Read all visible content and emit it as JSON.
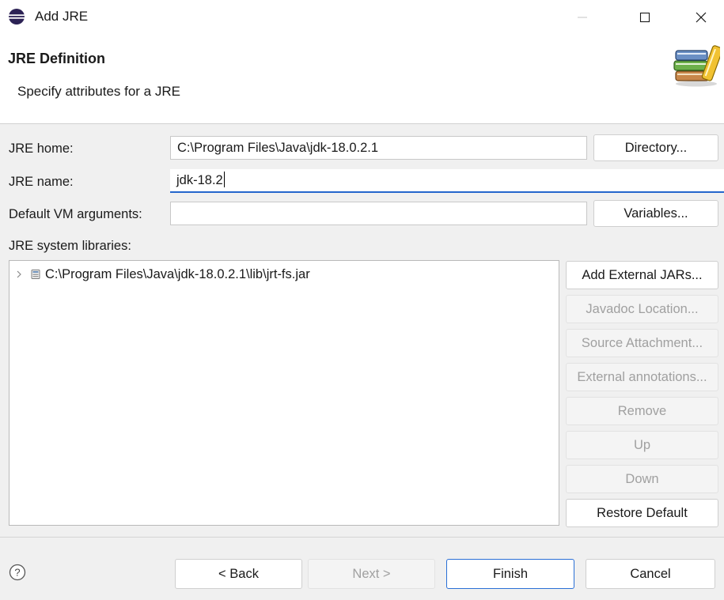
{
  "window": {
    "title": "Add JRE"
  },
  "header": {
    "title": "JRE Definition",
    "description": "Specify attributes for a JRE"
  },
  "form": {
    "jre_home": {
      "label": "JRE home:",
      "value": "C:\\Program Files\\Java\\jdk-18.0.2.1"
    },
    "jre_name": {
      "label": "JRE name:",
      "value": "jdk-18.2"
    },
    "vm_args": {
      "label": "Default VM arguments:",
      "value": ""
    },
    "libraries_label": "JRE system libraries:",
    "directory_button": "Directory...",
    "variables_button": "Variables..."
  },
  "libraries": {
    "items": [
      {
        "label": "C:\\Program Files\\Java\\jdk-18.0.2.1\\lib\\jrt-fs.jar",
        "icon": "jar-icon",
        "expanded": false
      }
    ],
    "buttons": [
      {
        "label": "Add External JARs...",
        "enabled": true
      },
      {
        "label": "Javadoc Location...",
        "enabled": false
      },
      {
        "label": "Source Attachment...",
        "enabled": false
      },
      {
        "label": "External annotations...",
        "enabled": false
      },
      {
        "label": "Remove",
        "enabled": false
      },
      {
        "label": "Up",
        "enabled": false
      },
      {
        "label": "Down",
        "enabled": false
      },
      {
        "label": "Restore Default",
        "enabled": true
      }
    ]
  },
  "footer": {
    "back": "< Back",
    "next": "Next >",
    "finish": "Finish",
    "cancel": "Cancel"
  },
  "colors": {
    "focus_accent": "#2466cc",
    "default_button_border": "#2a6fd6",
    "disabled_text": "#a0a0a0",
    "content_background": "#f0f0f0"
  }
}
